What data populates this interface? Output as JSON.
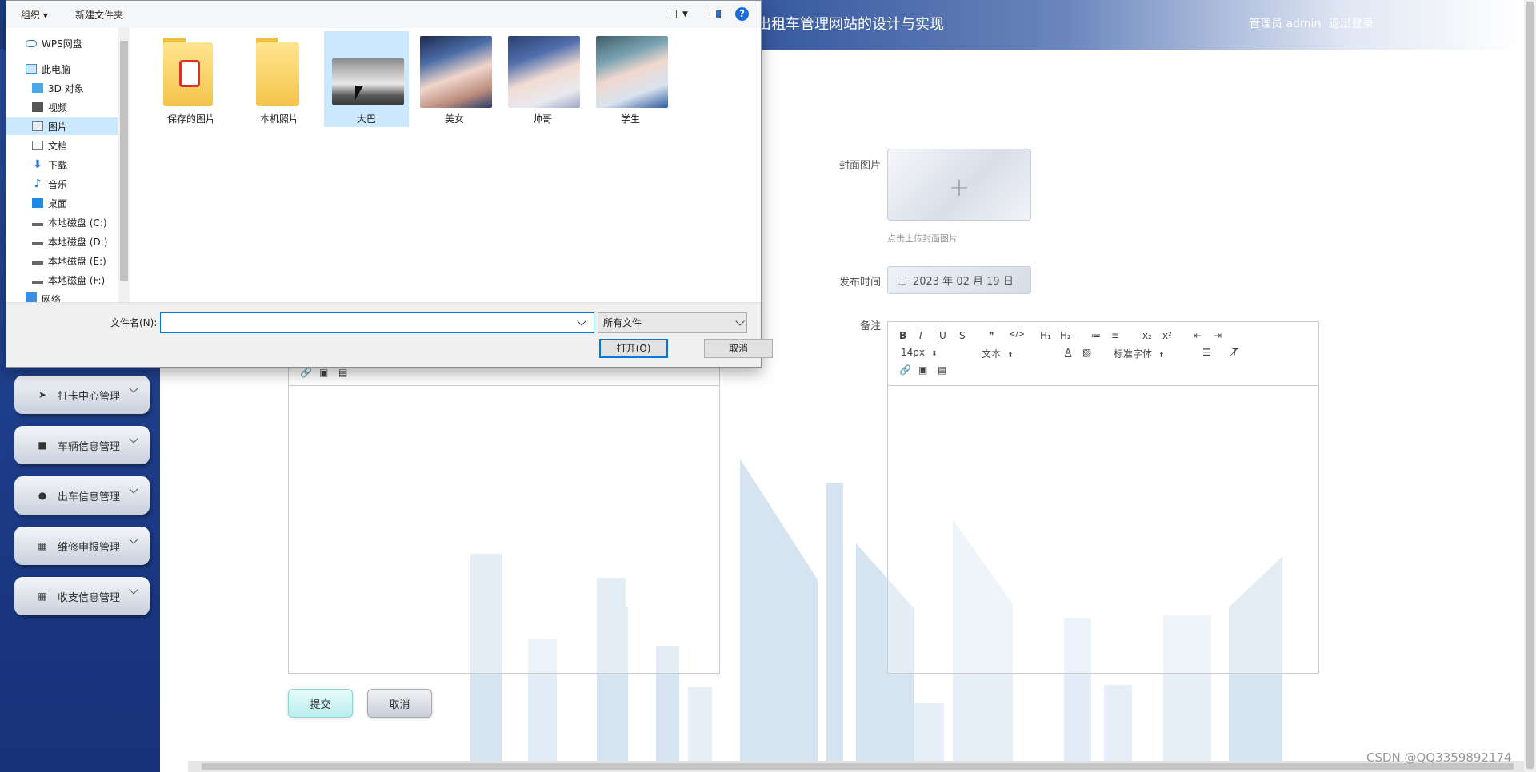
{
  "app": {
    "title": "出租车管理网站的设计与实现",
    "user_role": "管理员 admin",
    "logout": "退出登录"
  },
  "sidebar": {
    "items": [
      {
        "label": "打卡中心管理",
        "icon": "send-icon"
      },
      {
        "label": "车辆信息管理",
        "icon": "car-icon"
      },
      {
        "label": "出车信息管理",
        "icon": "person-icon"
      },
      {
        "label": "维修申报管理",
        "icon": "grid-icon"
      },
      {
        "label": "收支信息管理",
        "icon": "grid-icon"
      }
    ]
  },
  "form": {
    "cover_label": "封面图片",
    "cover_hint": "点击上传封面图片",
    "publish_label": "发布时间",
    "publish_value": "2023 年 02 月 19 日",
    "remark_label": "备注",
    "submit": "提交",
    "cancel": "取消"
  },
  "editor": {
    "font_size": "14px",
    "text_type": "文本",
    "font_family": "标准字体",
    "buttons": [
      "B",
      "I",
      "U",
      "S",
      "❞",
      "</>",
      "H₁",
      "H₂",
      "≔",
      "≡",
      "x₂",
      "x²",
      "⇤",
      "⇥"
    ]
  },
  "dialog": {
    "organize": "组织 ▾",
    "new_folder": "新建文件夹",
    "help": "?",
    "nav": [
      {
        "label": "WPS网盘",
        "icon": "cloud-icon"
      },
      {
        "label": "此电脑",
        "icon": "computer-icon"
      },
      {
        "label": "3D 对象",
        "icon": "cube-icon"
      },
      {
        "label": "视频",
        "icon": "video-icon"
      },
      {
        "label": "图片",
        "icon": "picture-icon"
      },
      {
        "label": "文档",
        "icon": "document-icon"
      },
      {
        "label": "下载",
        "icon": "download-icon"
      },
      {
        "label": "音乐",
        "icon": "music-icon"
      },
      {
        "label": "桌面",
        "icon": "desktop-icon"
      },
      {
        "label": "本地磁盘 (C:)",
        "icon": "drive-icon"
      },
      {
        "label": "本地磁盘 (D:)",
        "icon": "drive-icon"
      },
      {
        "label": "本地磁盘 (E:)",
        "icon": "drive-icon"
      },
      {
        "label": "本地磁盘 (F:)",
        "icon": "drive-icon"
      },
      {
        "label": "网络",
        "icon": "network-icon"
      }
    ],
    "files": [
      {
        "label": "保存的图片",
        "kind": "folder"
      },
      {
        "label": "本机照片",
        "kind": "folder"
      },
      {
        "label": "大巴",
        "kind": "image"
      },
      {
        "label": "美女",
        "kind": "image"
      },
      {
        "label": "帅哥",
        "kind": "image"
      },
      {
        "label": "学生",
        "kind": "image"
      }
    ],
    "filename_label": "文件名(N):",
    "filename_value": "",
    "filetype": "所有文件",
    "open": "打开(O)",
    "cancel": "取消"
  },
  "watermark": "CSDN @QQ3359892174",
  "colors": {
    "header_start": "#1d3b82",
    "sidebar": "#1c3a85",
    "selection": "#cce8ff",
    "accent": "#0078d7"
  }
}
